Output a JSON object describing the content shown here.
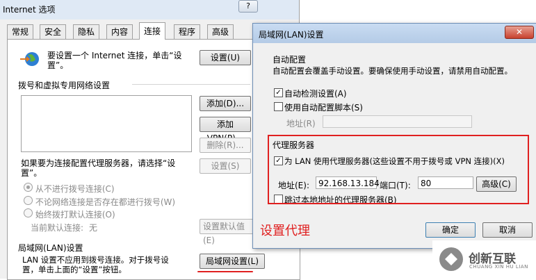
{
  "options_window": {
    "title": "Internet 选项",
    "help_btn": "?",
    "tabs": [
      "常规",
      "安全",
      "隐私",
      "内容",
      "连接",
      "程序",
      "高级"
    ],
    "active_tab": "连接",
    "setup_text": "要设置一个 Internet 连接，单击“设置”。",
    "setup_btn": "设置(U)",
    "dialup_group": "拨号和虚拟专用网络设置",
    "add_btn": "添加(D)...",
    "add_vpn_btn": "添加 VPN(P)...",
    "remove_btn": "删除(R)...",
    "proxy_note": "如果要为连接配置代理服务器，请选择“设置”。",
    "settings_btn": "设置(S)",
    "radio_never": "从不进行拨号连接(C)",
    "radio_nonet": "不论网络连接是否存在都进行拨号(W)",
    "radio_always": "始终拨打默认连接(O)",
    "current_default_label": "当前默认连接:",
    "current_default_value": "无",
    "set_default_btn": "设置默认值(E)",
    "lan_group": "局域网(LAN)设置",
    "lan_note": "LAN 设置不应用到拨号连接。对于拨号设置，单击上面的“设置”按钮。",
    "lan_btn": "局域网设置(L)"
  },
  "lan_dialog": {
    "title": "局域网(LAN)设置",
    "close_btn": "✕",
    "auto_group": "自动配置",
    "auto_desc": "自动配置会覆盖手动设置。要确保使用手动设置，请禁用自动配置。",
    "auto_detect": "自动检测设置(A)",
    "auto_script": "使用自动配置脚本(S)",
    "address_label_disabled": "地址(R)",
    "proxy_group": "代理服务器",
    "use_proxy": "为 LAN 使用代理服务器(这些设置不用于拨号或 VPN 连接)(X)",
    "address_label": "地址(E):",
    "address_value": "92.168.13.184",
    "port_label": "端口(T):",
    "port_value": "80",
    "advanced_btn": "高级(C)",
    "bypass_local": "跳过本地地址的代理服务器(B)",
    "ok_btn": "确定",
    "cancel_btn": "取消"
  },
  "annotation": "设置代理",
  "watermark": {
    "name": "创新互联",
    "sub": "CHUANG XIN HU LIAN"
  },
  "colors": {
    "annotation_red": "#e02020",
    "title_blue": "#b4cbe6"
  }
}
